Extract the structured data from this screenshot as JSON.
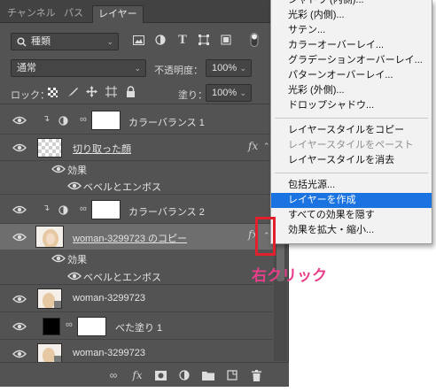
{
  "tabs": [
    "チャンネル",
    "パス",
    "レイヤー"
  ],
  "filter": {
    "kind": "種類"
  },
  "blend": {
    "mode": "通常",
    "opacity_label": "不透明度：",
    "opacity_value": "100%"
  },
  "lock": {
    "label": "ロック：",
    "fill_label": "塗り：",
    "fill_value": "100%"
  },
  "layers": [
    {
      "name": "カラーバランス 1"
    },
    {
      "name": "切り取った顔",
      "fx": "fx"
    },
    {
      "name": "効果"
    },
    {
      "name": "ベベルとエンボス"
    },
    {
      "name": "カラーバランス 2"
    },
    {
      "name": "woman-3299723 のコピー",
      "fx": "fx"
    },
    {
      "name": "効果"
    },
    {
      "name": "ベベルとエンボス"
    },
    {
      "name": "woman-3299723"
    },
    {
      "name": "べた塗り 1"
    },
    {
      "name": "woman-3299723"
    }
  ],
  "menu": [
    "シャドウ (内側)...",
    "光彩 (内側)...",
    "サテン...",
    "カラーオーバーレイ...",
    "グラデーションオーバーレイ...",
    "パターンオーバーレイ...",
    "光彩 (外側)...",
    "ドロップシャドウ...",
    "レイヤースタイルをコピー",
    "レイヤースタイルをペースト",
    "レイヤースタイルを消去",
    "包括光源...",
    "レイヤーを作成",
    "すべての効果を隠す",
    "効果を拡大・縮小..."
  ],
  "annotation": "右クリック",
  "colors": {
    "highlight": "#1a73e0",
    "annotation": "#e83d8a",
    "marker": "#e0202a"
  }
}
